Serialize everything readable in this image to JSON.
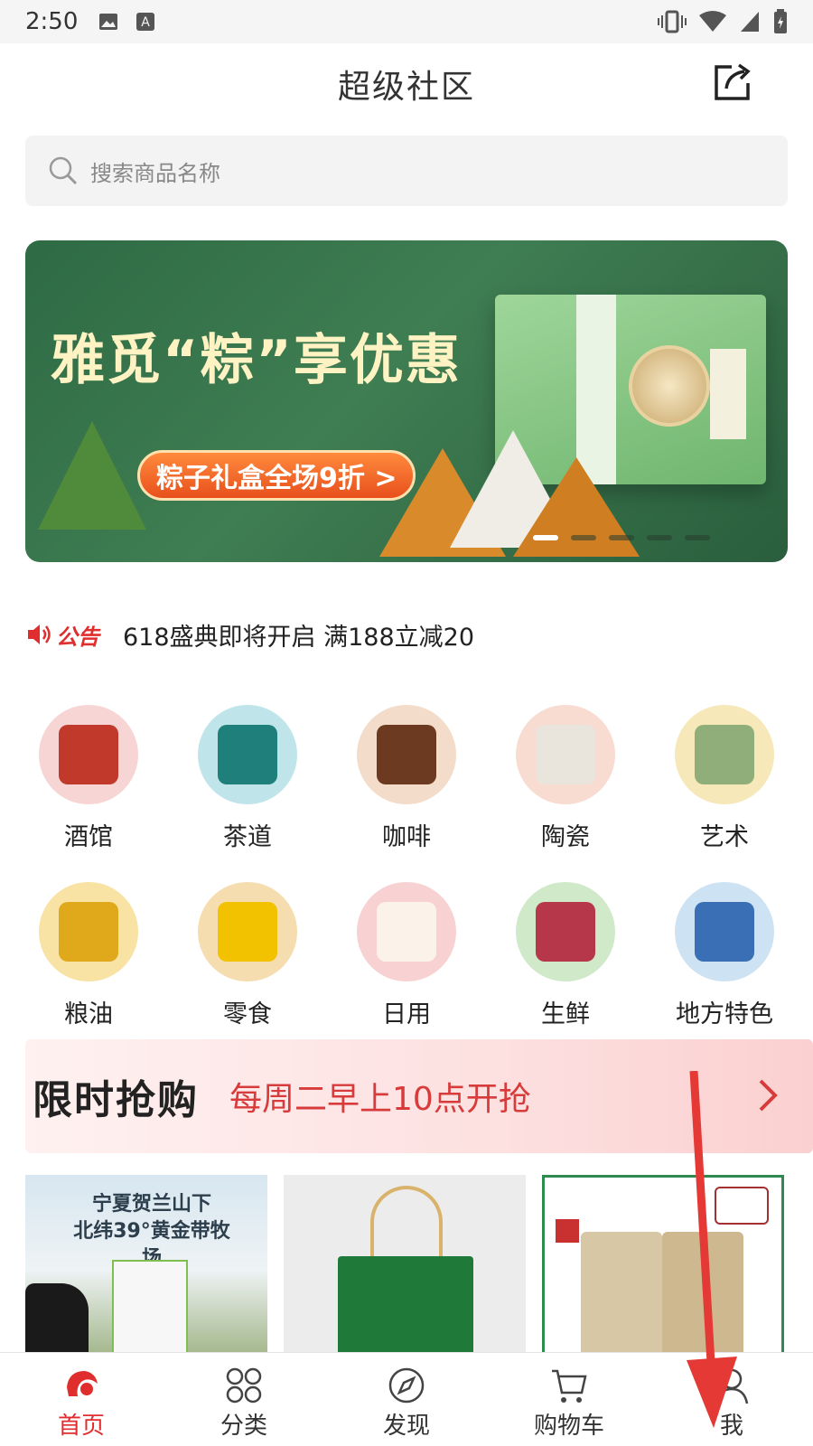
{
  "status_bar": {
    "time": "2:50",
    "icons": [
      "image-icon",
      "keyboard-a-icon",
      "vibrate-icon",
      "wifi-icon",
      "signal-icon",
      "battery-icon"
    ]
  },
  "header": {
    "title": "超级社区",
    "share_icon": "share-icon"
  },
  "search": {
    "placeholder": "搜索商品名称"
  },
  "banner": {
    "headline": "雅觅“粽”享优惠",
    "cta": "粽子礼盒全场9折 >",
    "slides": 5,
    "active_slide": 1
  },
  "notice": {
    "tag": "公告",
    "text": "618盛典即将开启 满188立减20"
  },
  "categories": [
    {
      "label": "酒馆"
    },
    {
      "label": "茶道"
    },
    {
      "label": "咖啡"
    },
    {
      "label": "陶瓷"
    },
    {
      "label": "艺术"
    },
    {
      "label": "粮油"
    },
    {
      "label": "零食"
    },
    {
      "label": "日用"
    },
    {
      "label": "生鲜"
    },
    {
      "label": "地方特色"
    }
  ],
  "flash_sale": {
    "title": "限时抢购",
    "subtitle": "每周二早上10点开抢"
  },
  "products": [
    {
      "banner_text_1": "宁夏贺兰山下",
      "banner_text_2": "北纬39°黄金带牧场"
    },
    {},
    {}
  ],
  "bottom_nav": [
    {
      "label": "首页",
      "icon": "home-icon",
      "active": true
    },
    {
      "label": "分类",
      "icon": "category-icon",
      "active": false
    },
    {
      "label": "发现",
      "icon": "compass-icon",
      "active": false
    },
    {
      "label": "购物车",
      "icon": "cart-icon",
      "active": false
    },
    {
      "label": "我",
      "icon": "profile-icon",
      "active": false
    }
  ],
  "colors": {
    "accent_red": "#e02d2d",
    "banner_green": "#2e6b45",
    "flash_bg": "#fde0e0"
  }
}
